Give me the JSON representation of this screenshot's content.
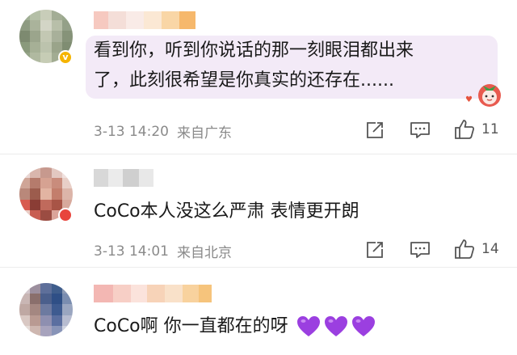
{
  "comments": [
    {
      "text_line1": "看到你，听到你说话的那一刻眼泪都出来",
      "text_line2": "了，此刻很希望是你真实的还存在......",
      "time": "3-13 14:20",
      "location": "来自广东",
      "like_count": "11",
      "badge": "verified",
      "highlighted": true
    },
    {
      "text": "CoCo本人没这么严肃 表情更开朗",
      "time": "3-13 14:01",
      "location": "来自北京",
      "like_count": "14",
      "badge": "red"
    },
    {
      "text": "CoCo啊 你一直都在的呀",
      "emoji": [
        "purple-heart",
        "purple-heart",
        "purple-heart"
      ]
    }
  ],
  "colors": {
    "bubble": "#f3eaf7",
    "purple_heart": "#9b3fe0",
    "verified_badge": "#f5b400"
  },
  "icons": [
    "share-icon",
    "comment-icon",
    "like-icon",
    "strawberry-sticker-icon"
  ]
}
